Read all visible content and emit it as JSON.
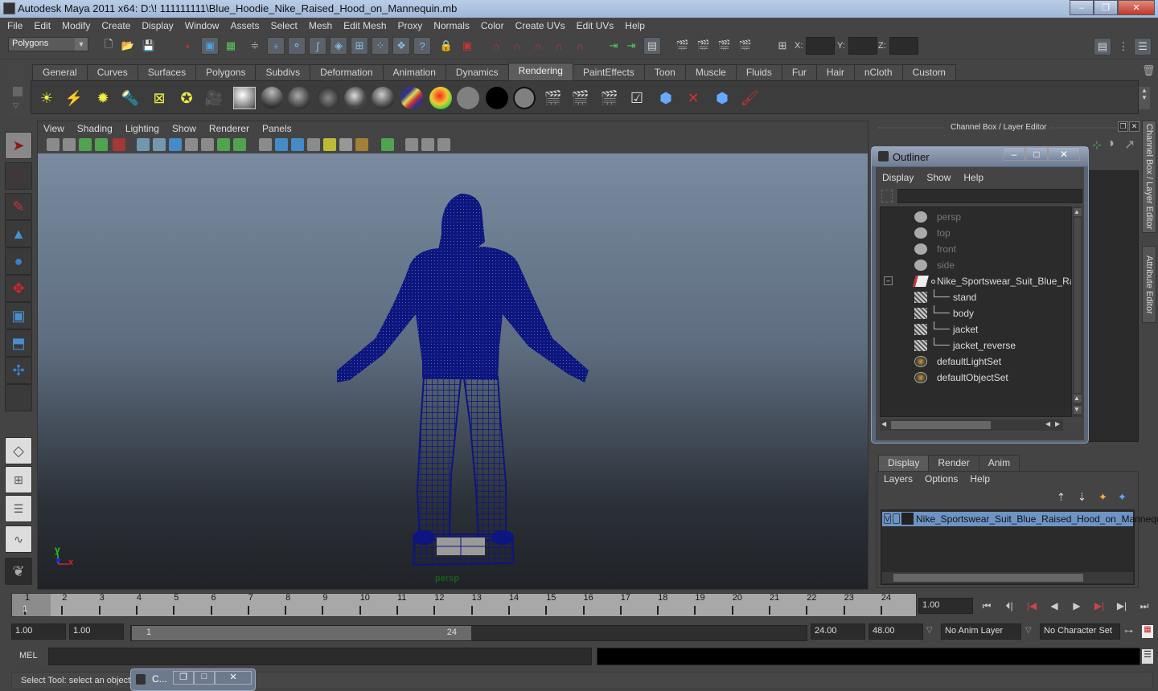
{
  "window": {
    "title": "Autodesk Maya 2011 x64: D:\\! 111111111\\Blue_Hoodie_Nike_Raised_Hood_on_Mannequin.mb",
    "minimize": "–",
    "restore": "❐",
    "close": "✕"
  },
  "menubar": [
    "File",
    "Edit",
    "Modify",
    "Create",
    "Display",
    "Window",
    "Assets",
    "Select",
    "Mesh",
    "Edit Mesh",
    "Proxy",
    "Normals",
    "Color",
    "Create UVs",
    "Edit UVs",
    "Help"
  ],
  "statusline": {
    "menu_set": "Polygons",
    "x_label": "X:",
    "y_label": "Y:",
    "z_label": "Z:",
    "x_value": "",
    "y_value": "",
    "z_value": ""
  },
  "shelf": {
    "tabs": [
      "General",
      "Curves",
      "Surfaces",
      "Polygons",
      "Subdivs",
      "Deformation",
      "Animation",
      "Dynamics",
      "Rendering",
      "PaintEffects",
      "Toon",
      "Muscle",
      "Fluids",
      "Fur",
      "Hair",
      "nCloth",
      "Custom"
    ],
    "active_tab": "Rendering",
    "icons": [
      "ambient-light",
      "directional-light",
      "point-light",
      "spot-light",
      "area-light",
      "volume-light",
      "camera",
      "render-view",
      "blinn",
      "lambert",
      "phong",
      "phong-e",
      "anisotropic",
      "ramp-shader",
      "surface-shader",
      "use-background",
      "layered-shader",
      "shading-map",
      "render-current-frame",
      "ipr-render",
      "batch-render",
      "render-settings",
      "hypershade",
      "hypershade-disabled",
      "hypershade-window",
      "paint-tool"
    ]
  },
  "viewport": {
    "menu": [
      "View",
      "Shading",
      "Lighting",
      "Show",
      "Renderer",
      "Panels"
    ],
    "camera_label": "persp",
    "axis": {
      "y": "y",
      "x": "x",
      "z": "z"
    },
    "model_color": "#0c1580"
  },
  "channel_box": {
    "title": "Channel Box / Layer Editor",
    "side_tabs": [
      "Channel Box / Layer Editor",
      "Attribute Editor"
    ]
  },
  "outliner": {
    "title": "Outliner",
    "menu": [
      "Display",
      "Show",
      "Help"
    ],
    "items": [
      {
        "label": "persp",
        "icon": "camera",
        "dim": true,
        "indent": 0
      },
      {
        "label": "top",
        "icon": "camera",
        "dim": true,
        "indent": 0
      },
      {
        "label": "front",
        "icon": "camera",
        "dim": true,
        "indent": 0
      },
      {
        "label": "side",
        "icon": "camera",
        "dim": true,
        "indent": 0
      },
      {
        "label": "Nike_Sportswear_Suit_Blue_Raised",
        "icon": "group",
        "dim": false,
        "indent": 0,
        "expanded": true
      },
      {
        "label": "stand",
        "icon": "mesh",
        "dim": false,
        "indent": 1
      },
      {
        "label": "body",
        "icon": "mesh",
        "dim": false,
        "indent": 1
      },
      {
        "label": "jacket",
        "icon": "mesh",
        "dim": false,
        "indent": 1
      },
      {
        "label": "jacket_reverse",
        "icon": "mesh",
        "dim": false,
        "indent": 1
      },
      {
        "label": "defaultLightSet",
        "icon": "set",
        "dim": false,
        "indent": 0
      },
      {
        "label": "defaultObjectSet",
        "icon": "set",
        "dim": false,
        "indent": 0
      }
    ]
  },
  "layer_editor": {
    "tabs": [
      "Display",
      "Render",
      "Anim"
    ],
    "active_tab": "Display",
    "menu": [
      "Layers",
      "Options",
      "Help"
    ],
    "layers": [
      {
        "visible": "V",
        "name": "Nike_Sportswear_Suit_Blue_Raised_Hood_on_Mannequin"
      }
    ]
  },
  "timeline": {
    "ticks": [
      "1",
      "2",
      "3",
      "4",
      "5",
      "6",
      "7",
      "8",
      "9",
      "10",
      "11",
      "12",
      "13",
      "14",
      "15",
      "16",
      "17",
      "18",
      "19",
      "20",
      "21",
      "22",
      "23",
      "24"
    ],
    "current_marker": "1",
    "current_frame": "1.00"
  },
  "range": {
    "start": "1.00",
    "playback_start": "1.00",
    "slider_start": "1",
    "slider_end": "24",
    "playback_end": "24.00",
    "end": "48.00",
    "anim_layer": "No Anim Layer",
    "character_set": "No Character Set"
  },
  "command": {
    "label": "MEL"
  },
  "helpline": {
    "text": "Select Tool: select an object",
    "minimized_window": "C..."
  }
}
